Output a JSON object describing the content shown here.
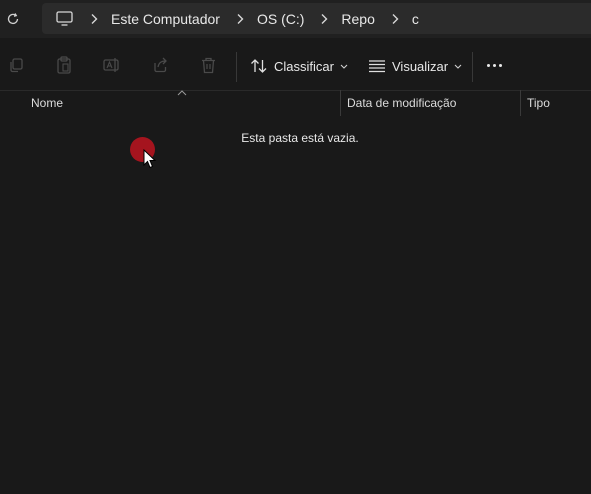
{
  "address_bar": {
    "segments": [
      "Este Computador",
      "OS (C:)",
      "Repo",
      "c"
    ]
  },
  "toolbar": {
    "sort_label": "Classificar",
    "view_label": "Visualizar"
  },
  "columns": {
    "name": "Nome",
    "modified": "Data de modificação",
    "type": "Tipo"
  },
  "content": {
    "empty_message": "Esta pasta está vazia."
  },
  "colors": {
    "background": "#191919",
    "address_bar": "#2b2b2b",
    "cursor_highlight": "#a5141e"
  }
}
